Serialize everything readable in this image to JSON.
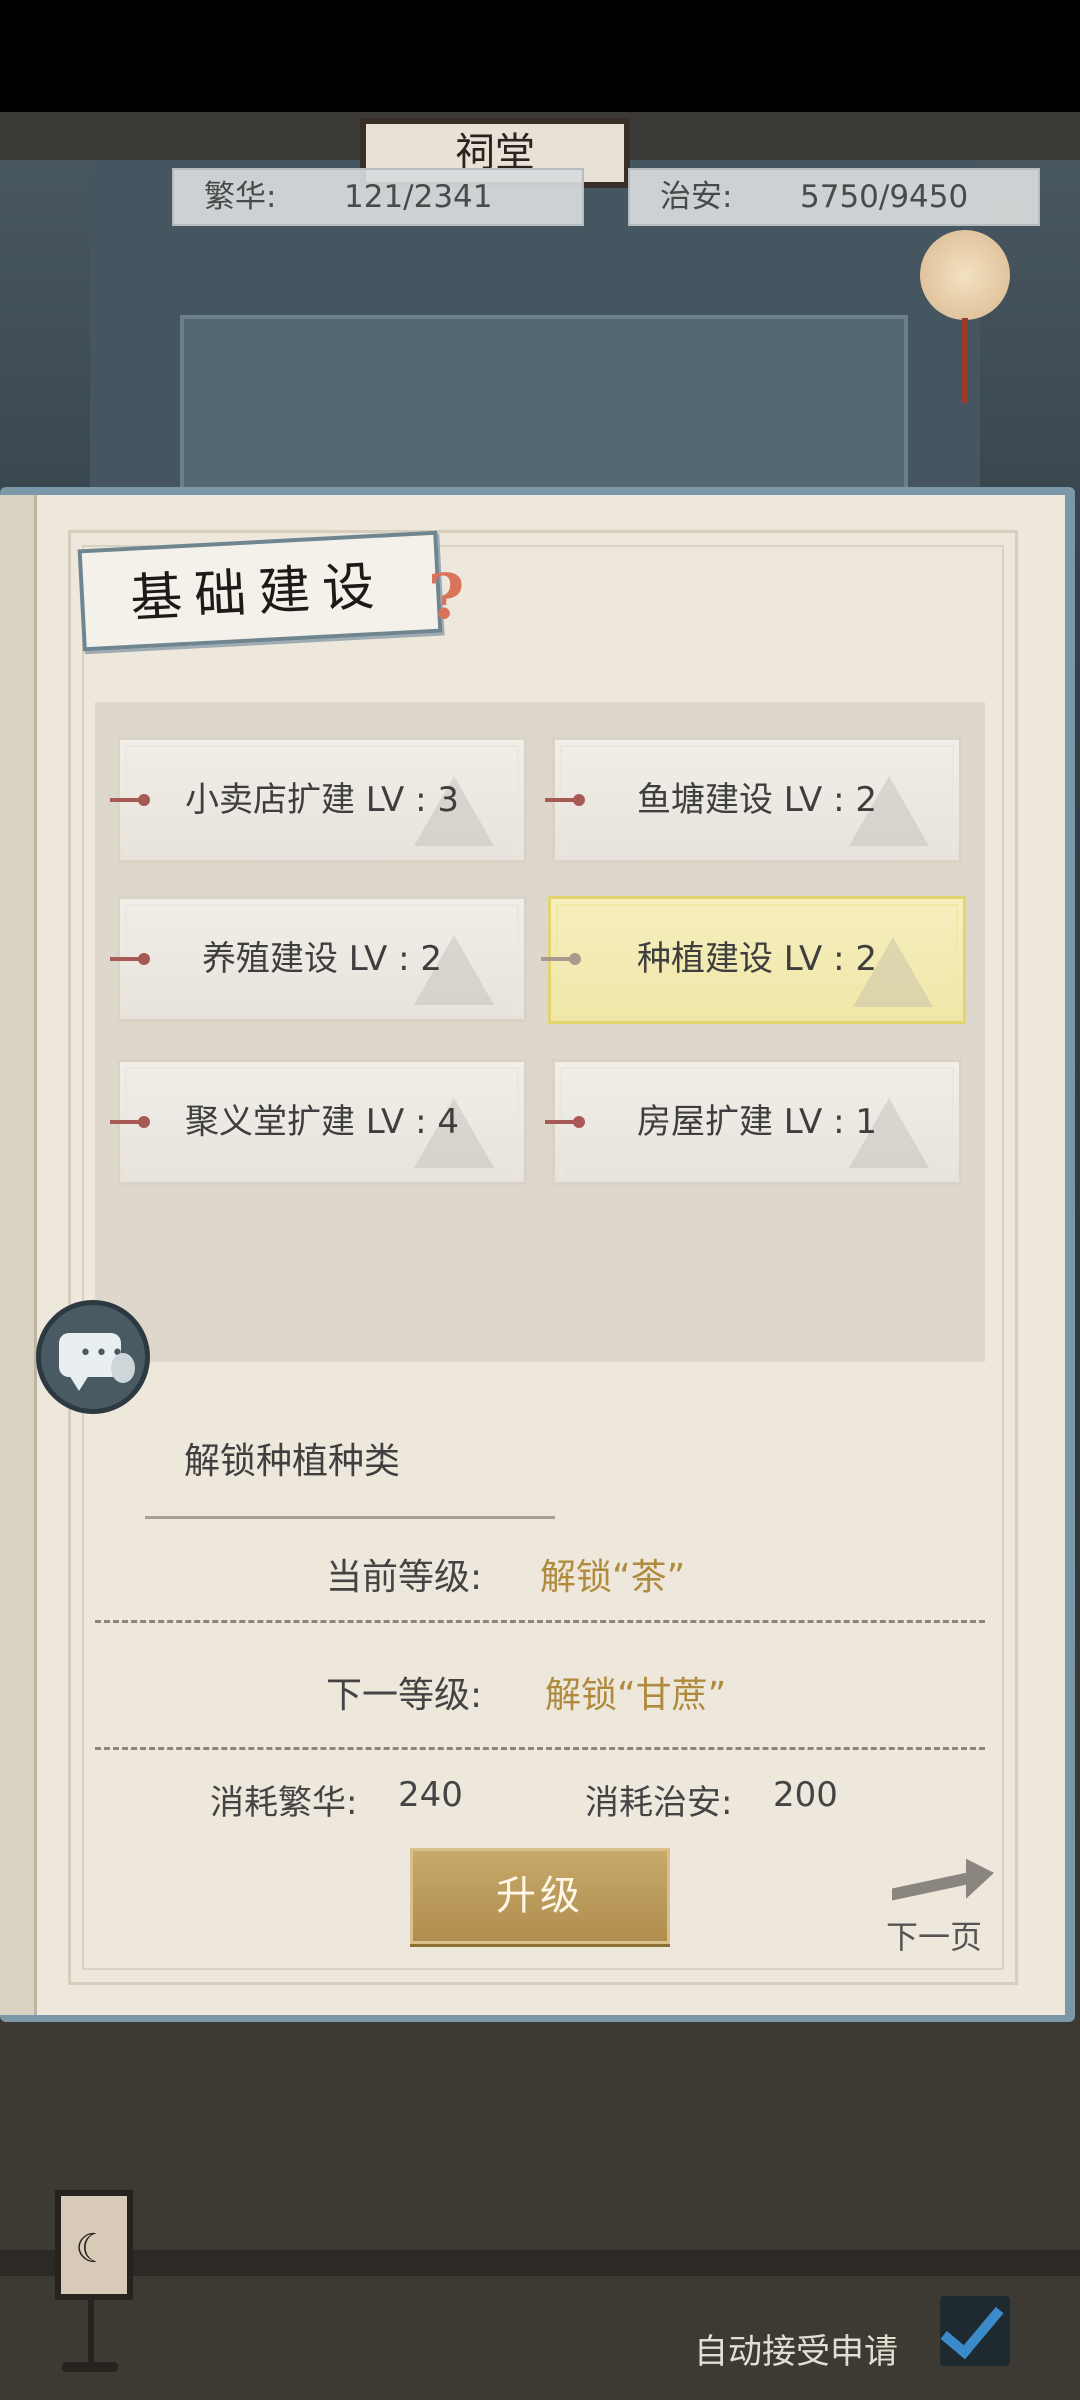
{
  "header": {
    "hall_name": "祠堂",
    "prosperity": {
      "label": "繁华:",
      "value": "121/2341"
    },
    "security": {
      "label": "治安:",
      "value": "5750/9450"
    }
  },
  "panel": {
    "title": "基础建设",
    "help": "?",
    "items": [
      {
        "label": "小卖店扩建 LV : 3",
        "selected": false
      },
      {
        "label": "鱼塘建设 LV : 2",
        "selected": false
      },
      {
        "label": "养殖建设 LV : 2",
        "selected": false
      },
      {
        "label": "种植建设 LV : 2",
        "selected": true
      },
      {
        "label": "聚义堂扩建 LV : 4",
        "selected": false
      },
      {
        "label": "房屋扩建 LV : 1",
        "selected": false
      }
    ]
  },
  "detail": {
    "title": "解锁种植种类",
    "current_label": "当前等级:",
    "current_value": "解锁“茶”",
    "next_label": "下一等级:",
    "next_value": "解锁“甘蔗”",
    "cost_prosperity_label": "消耗繁华:",
    "cost_prosperity_value": "240",
    "cost_security_label": "消耗治安:",
    "cost_security_value": "200",
    "upgrade_label": "升级",
    "next_page_label": "下一页"
  },
  "footer": {
    "auto_accept_label": "自动接受申请",
    "auto_accept_checked": true
  },
  "icons": {
    "chat": "chat-icon",
    "lamp": "lamp-icon",
    "help": "question-icon",
    "next": "arrow-right-icon",
    "check": "checkmark-icon"
  },
  "colors": {
    "highlight": "#f6efbe",
    "accent_text": "#b08b3e",
    "button": "#c7a96a"
  }
}
